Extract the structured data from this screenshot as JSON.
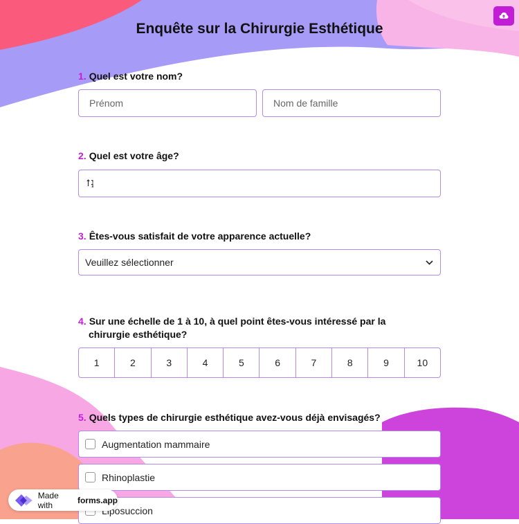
{
  "title": "Enquête sur la Chirurgie Esthétique",
  "colors": {
    "accent": "#c21ed6",
    "border": "#b48ae8"
  },
  "upload_icon": "cloud-upload-icon",
  "q1": {
    "num": "1.",
    "text": "Quel est votre nom?",
    "first_placeholder": "Prénom",
    "last_placeholder": "Nom de famille"
  },
  "q2": {
    "num": "2.",
    "text": "Quel est votre âge?",
    "icon": "sort-numeric-icon",
    "value": ""
  },
  "q3": {
    "num": "3.",
    "text": "Êtes-vous satisfait de votre apparence actuelle?",
    "selected": "Veuillez sélectionner"
  },
  "q4": {
    "num": "4.",
    "text": "Sur une échelle de 1 à 10, à quel point êtes-vous intéressé par la chirurgie esthétique?",
    "scale": [
      "1",
      "2",
      "3",
      "4",
      "5",
      "6",
      "7",
      "8",
      "9",
      "10"
    ]
  },
  "q5": {
    "num": "5.",
    "text": "Quels types de chirurgie esthétique avez-vous déjà envisagés?",
    "options": [
      "Augmentation mammaire",
      "Rhinoplastie",
      "Liposuccion"
    ]
  },
  "badge": {
    "prefix": "Made with",
    "brand": "forms.app"
  }
}
